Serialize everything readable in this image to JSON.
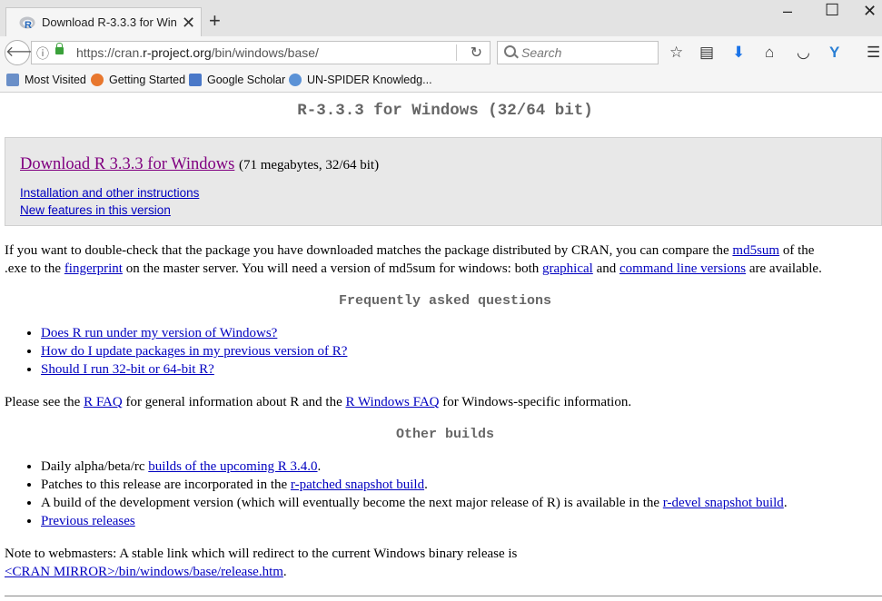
{
  "browser": {
    "tab_title": "Download R-3.3.3 for Win...",
    "url_host_prefix": "https://cran.",
    "url_host_main": "r-project.org",
    "url_path": "/bin/windows/base/",
    "search_placeholder": "Search",
    "bookmarks": [
      "Most Visited",
      "Getting Started",
      "Google Scholar",
      "UN-SPIDER Knowledg..."
    ]
  },
  "page": {
    "title": "R-3.3.3 for Windows (32/64 bit)",
    "download_link": "Download R 3.3.3 for Windows",
    "download_size": "(71 megabytes, 32/64 bit)",
    "install_link": "Installation and other instructions",
    "features_link": "New features in this version",
    "md5": {
      "t1": "If you want to double-check that the package you have downloaded matches the package distributed by CRAN, you can compare the ",
      "link1": "md5sum",
      "t2": " of the",
      "t3": ".exe to the ",
      "link2": "fingerprint",
      "t4": " on the master server. You will need a version of md5sum for windows: both ",
      "link3": "graphical",
      "t5": " and ",
      "link4": "command line versions",
      "t6": " are available."
    },
    "faq_heading": "Frequently asked questions",
    "faq_items": [
      "Does R run under my version of Windows?",
      "How do I update packages in my previous version of R?",
      "Should I run 32-bit or 64-bit R?"
    ],
    "rfaq": {
      "t1": "Please see the ",
      "link1": "R FAQ",
      "t2": " for general information about R and the ",
      "link2": "R Windows FAQ",
      "t3": " for Windows-specific information."
    },
    "builds_heading": "Other builds",
    "builds": {
      "b1_text": "Daily alpha/beta/rc ",
      "b1_link": "builds of the upcoming R 3.4.0",
      "b1_end": ".",
      "b2_text": "Patches to this release are incorporated in the ",
      "b2_link": "r-patched snapshot build",
      "b2_end": ".",
      "b3_text": "A build of the development version (which will eventually become the next major release of R) is available in the ",
      "b3_link": "r-devel snapshot build",
      "b3_end": ".",
      "b4_link": "Previous releases"
    },
    "note_text": "Note to webmasters: A stable link which will redirect to the current Windows binary release is",
    "note_link": "<CRAN MIRROR>/bin/windows/base/release.htm",
    "note_end": "."
  }
}
